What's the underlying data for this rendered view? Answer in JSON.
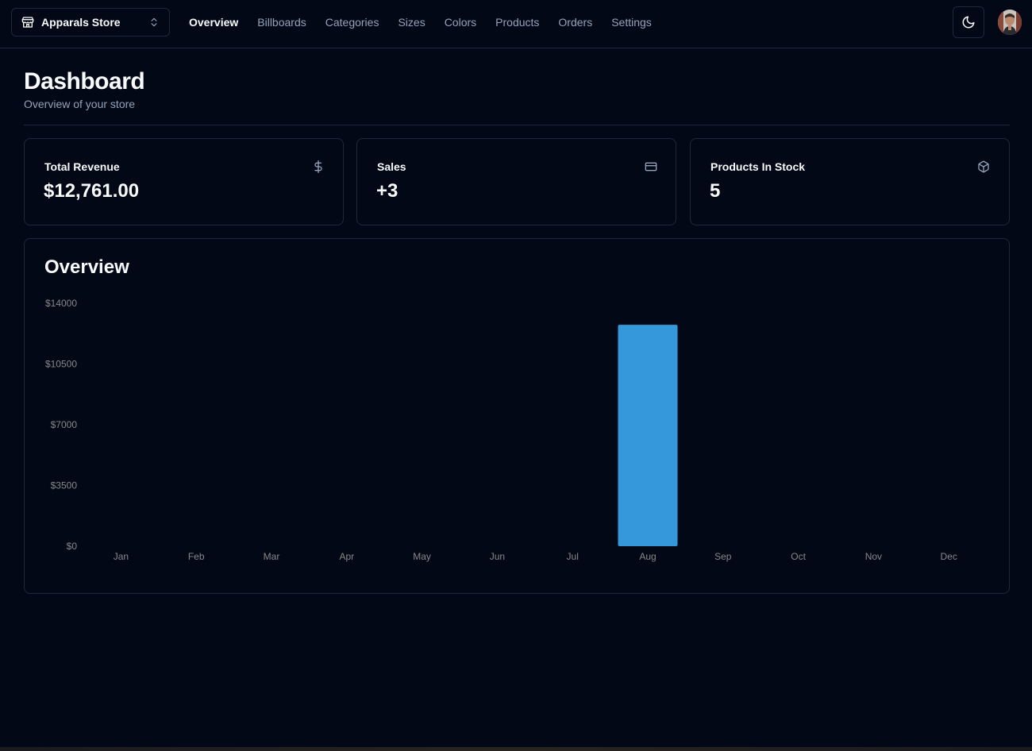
{
  "header": {
    "store_name": "Apparals Store",
    "nav": [
      {
        "label": "Overview",
        "active": true
      },
      {
        "label": "Billboards",
        "active": false
      },
      {
        "label": "Categories",
        "active": false
      },
      {
        "label": "Sizes",
        "active": false
      },
      {
        "label": "Colors",
        "active": false
      },
      {
        "label": "Products",
        "active": false
      },
      {
        "label": "Orders",
        "active": false
      },
      {
        "label": "Settings",
        "active": false
      }
    ],
    "theme_icon": "moon-icon"
  },
  "page": {
    "title": "Dashboard",
    "subtitle": "Overview of your store"
  },
  "stats": [
    {
      "title": "Total Revenue",
      "value": "$12,761.00",
      "icon": "dollar-icon"
    },
    {
      "title": "Sales",
      "value": "+3",
      "icon": "credit-card-icon"
    },
    {
      "title": "Products In Stock",
      "value": "5",
      "icon": "package-icon"
    }
  ],
  "overview": {
    "title": "Overview"
  },
  "chart_data": {
    "type": "bar",
    "categories": [
      "Jan",
      "Feb",
      "Mar",
      "Apr",
      "May",
      "Jun",
      "Jul",
      "Aug",
      "Sep",
      "Oct",
      "Nov",
      "Dec"
    ],
    "values": [
      0,
      0,
      0,
      0,
      0,
      0,
      0,
      12761,
      0,
      0,
      0,
      0
    ],
    "yticks": [
      0,
      3500,
      7000,
      10500,
      14000
    ],
    "ytick_labels": [
      "$0",
      "$3500",
      "$7000",
      "$10500",
      "$14000"
    ],
    "ylim": [
      0,
      14000
    ],
    "bar_color": "#3498db",
    "grid": false
  },
  "colors": {
    "background": "#030817",
    "border": "#1e293b",
    "muted_text": "#94a3b8",
    "bar": "#3498db"
  }
}
